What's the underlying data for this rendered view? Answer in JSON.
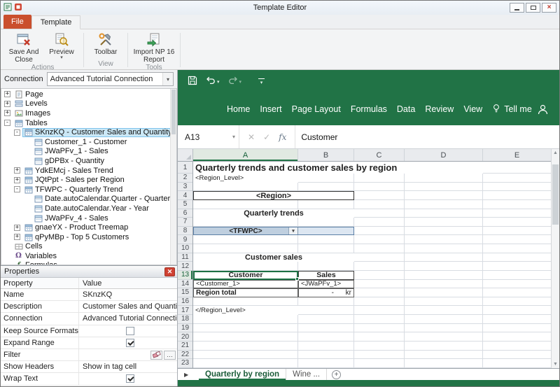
{
  "window": {
    "title": "Template Editor"
  },
  "tabs": {
    "file": "File",
    "template": "Template"
  },
  "ribbon": {
    "save_close": "Save And Close",
    "preview": "Preview",
    "toolbar": "Toolbar",
    "import_report": "Import NP 16 Report",
    "group_actions": "Actions",
    "group_view": "View",
    "group_tools": "Tools"
  },
  "connection": {
    "label": "Connection",
    "value": "Advanced Tutorial Connection"
  },
  "tree": {
    "items": [
      {
        "label": "Page",
        "depth": 0,
        "expander": "closed",
        "icon": "page"
      },
      {
        "label": "Levels",
        "depth": 0,
        "expander": "closed",
        "icon": "levels"
      },
      {
        "label": "Images",
        "depth": 0,
        "expander": "closed",
        "icon": "image"
      },
      {
        "label": "Tables",
        "depth": 0,
        "expander": "open",
        "icon": "table"
      },
      {
        "label": "SKnzKQ - Customer Sales and Quantity",
        "depth": 1,
        "expander": "open",
        "icon": "table",
        "selected": true
      },
      {
        "label": "Customer_1 - Customer",
        "depth": 2,
        "icon": "field"
      },
      {
        "label": "JWaPFv_1 - Sales",
        "depth": 2,
        "icon": "field"
      },
      {
        "label": "gDPBx - Quantity",
        "depth": 2,
        "icon": "field"
      },
      {
        "label": "YdkEMcj - Sales Trend",
        "depth": 1,
        "expander": "closed",
        "icon": "table"
      },
      {
        "label": "JQtPpt - Sales per Region",
        "depth": 1,
        "expander": "closed",
        "icon": "table"
      },
      {
        "label": "TFWPC - Quarterly Trend",
        "depth": 1,
        "expander": "open",
        "icon": "table"
      },
      {
        "label": "Date.autoCalendar.Quarter - Quarter",
        "depth": 2,
        "icon": "field"
      },
      {
        "label": "Date.autoCalendar.Year - Year",
        "depth": 2,
        "icon": "field"
      },
      {
        "label": "JWaPFv_4 - Sales",
        "depth": 2,
        "icon": "field"
      },
      {
        "label": "gnaeYX - Product Treemap",
        "depth": 1,
        "expander": "closed",
        "icon": "table"
      },
      {
        "label": "qPyMBp - Top 5 Customers",
        "depth": 1,
        "expander": "closed",
        "icon": "table"
      },
      {
        "label": "Cells",
        "depth": 0,
        "icon": "cells"
      },
      {
        "label": "Variables",
        "depth": 0,
        "icon": "variable"
      },
      {
        "label": "Formulas",
        "depth": 0,
        "icon": "formula"
      }
    ]
  },
  "properties": {
    "title": "Properties",
    "header": {
      "property": "Property",
      "value": "Value"
    },
    "rows": [
      {
        "property": "Name",
        "type": "text",
        "value": "SKnzKQ"
      },
      {
        "property": "Description",
        "type": "text",
        "value": "Customer Sales and Quantity"
      },
      {
        "property": "Connection",
        "type": "text",
        "value": "Advanced Tutorial Connection"
      },
      {
        "property": "Keep Source Formats",
        "type": "checkbox",
        "checked": false
      },
      {
        "property": "Expand Range",
        "type": "checkbox",
        "checked": true
      },
      {
        "property": "Filter",
        "type": "filter"
      },
      {
        "property": "Show Headers",
        "type": "text",
        "value": "Show in tag cell"
      },
      {
        "property": "Wrap Text",
        "type": "checkbox",
        "checked": true
      }
    ]
  },
  "excel": {
    "menu": [
      "Home",
      "Insert",
      "Page Layout",
      "Formulas",
      "Data",
      "Review",
      "View"
    ],
    "tell_me": "Tell me",
    "name_box": "A13",
    "fx_label": "fx",
    "formula_value": "Customer",
    "columns": [
      "A",
      "B",
      "C",
      "D",
      "E"
    ],
    "active_column": "A",
    "active_row": 13,
    "row_numbers": [
      1,
      2,
      3,
      4,
      5,
      6,
      7,
      8,
      9,
      10,
      11,
      12,
      13,
      14,
      15,
      16,
      17,
      18,
      19,
      20,
      21,
      22,
      23
    ],
    "cells": [
      {
        "row": 1,
        "col": "A",
        "span": 4,
        "text": "Quarterly trends and customer sales by region",
        "style": "title"
      },
      {
        "row": 2,
        "col": "A",
        "span": 1,
        "text": "<Region_Level>",
        "style": "tag"
      },
      {
        "row": 4,
        "col": "A",
        "span": 2,
        "text": "<Region>",
        "style": "region"
      },
      {
        "row": 6,
        "col": "A",
        "span": 2,
        "text": "Quarterly trends",
        "style": "section"
      },
      {
        "row": 8,
        "col": "B",
        "span": 1,
        "text": "",
        "style": "selfill"
      },
      {
        "row": 8,
        "col": "A",
        "span": 1,
        "text": "<TFWPC>",
        "style": "tagcombo"
      },
      {
        "row": 8,
        "col": "A",
        "span": 2,
        "text": "",
        "style": "rangesel"
      },
      {
        "row": 11,
        "col": "A",
        "span": 2,
        "text": "Customer sales",
        "style": "section"
      },
      {
        "row": 13,
        "col": "A",
        "span": 1,
        "text": "Customer",
        "style": "header-active"
      },
      {
        "row": 13,
        "col": "B",
        "span": 1,
        "text": "Sales",
        "style": "header"
      },
      {
        "row": 14,
        "col": "A",
        "span": 1,
        "text": "<Customer_1>",
        "style": "tagdata"
      },
      {
        "row": 14,
        "col": "B",
        "span": 1,
        "text": "<JWaPFv_1>",
        "style": "tagdata"
      },
      {
        "row": 15,
        "col": "A",
        "span": 1,
        "text": "Region total",
        "style": "total"
      },
      {
        "row": 15,
        "col": "B",
        "span": 1,
        "text": "-      kr",
        "style": "money"
      },
      {
        "row": 17,
        "col": "A",
        "span": 1,
        "text": "</Region_Level>",
        "style": "tag"
      }
    ],
    "sheet_tabs": {
      "active": "Quarterly by region",
      "other": "Wine ..."
    }
  },
  "colors": {
    "excel_green": "#217346",
    "file_tab_orange": "#ca4f2d",
    "tree_selection": "#cbe8f6"
  }
}
